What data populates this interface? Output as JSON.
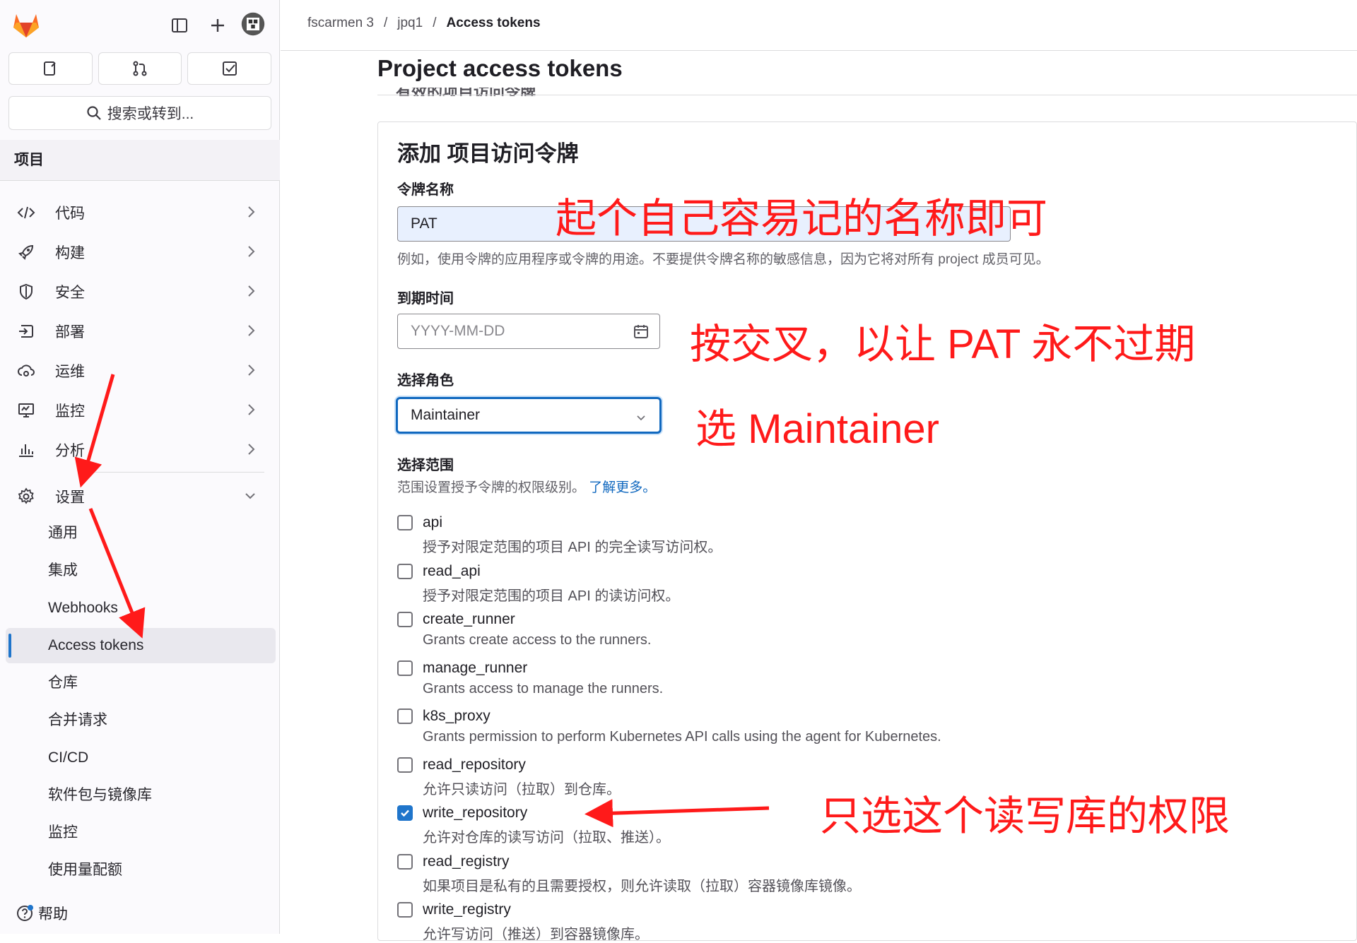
{
  "breadcrumb": {
    "group": "fscarmen 3",
    "project": "jpq1",
    "current": "Access tokens",
    "sep": "/"
  },
  "sidebar": {
    "search_label": "搜索或转到...",
    "section_title": "项目",
    "nav": [
      {
        "label": "代码",
        "icon": "code-icon"
      },
      {
        "label": "构建",
        "icon": "rocket-icon"
      },
      {
        "label": "安全",
        "icon": "shield-icon"
      },
      {
        "label": "部署",
        "icon": "deploy-icon"
      },
      {
        "label": "运维",
        "icon": "cloud-gear-icon"
      },
      {
        "label": "监控",
        "icon": "monitor-icon"
      },
      {
        "label": "分析",
        "icon": "chart-icon"
      },
      {
        "label": "设置",
        "icon": "gear-icon"
      }
    ],
    "settings_sub": [
      "通用",
      "集成",
      "Webhooks",
      "Access tokens",
      "仓库",
      "合并请求",
      "CI/CD",
      "软件包与镜像库",
      "监控",
      "使用量配额"
    ],
    "help_label": "帮助"
  },
  "main": {
    "page_title": "Project access tokens",
    "clipped_text": "有效的项目访问令牌",
    "form_title": "添加 项目访问令牌",
    "token_name": {
      "label": "令牌名称",
      "value": "PAT",
      "help": "例如，使用令牌的应用程序或令牌的用途。不要提供令牌名称的敏感信息，因为它将对所有 project 成员可见。"
    },
    "expiry": {
      "label": "到期时间",
      "placeholder": "YYYY-MM-DD"
    },
    "role": {
      "label": "选择角色",
      "value": "Maintainer"
    },
    "scopes": {
      "label": "选择范围",
      "help": "范围设置授予令牌的权限级别。",
      "learn_more": "了解更多。",
      "items": [
        {
          "name": "api",
          "desc": "授予对限定范围的项目 API 的完全读写访问权。",
          "checked": false
        },
        {
          "name": "read_api",
          "desc": "授予对限定范围的项目 API 的读访问权。",
          "checked": false
        },
        {
          "name": "create_runner",
          "desc": "Grants create access to the runners.",
          "checked": false
        },
        {
          "name": "manage_runner",
          "desc": "Grants access to manage the runners.",
          "checked": false
        },
        {
          "name": "k8s_proxy",
          "desc": "Grants permission to perform Kubernetes API calls using the agent for Kubernetes.",
          "checked": false
        },
        {
          "name": "read_repository",
          "desc": "允许只读访问（拉取）到仓库。",
          "checked": false
        },
        {
          "name": "write_repository",
          "desc": "允许对仓库的读写访问（拉取、推送）。",
          "checked": true
        },
        {
          "name": "read_registry",
          "desc": "如果项目是私有的且需要授权，则允许读取（拉取）容器镜像库镜像。",
          "checked": false
        },
        {
          "name": "write_registry",
          "desc": "允许写访问（推送）到容器镜像库。",
          "checked": false
        }
      ]
    }
  },
  "annotations": {
    "name_tip": "起个自己容易记的名称即可",
    "expiry_tip": "按交叉，以让 PAT 永不过期",
    "role_tip": "选 Maintainer",
    "scope_tip": "只选这个读写库的权限",
    "color": "#ff1a1a"
  }
}
